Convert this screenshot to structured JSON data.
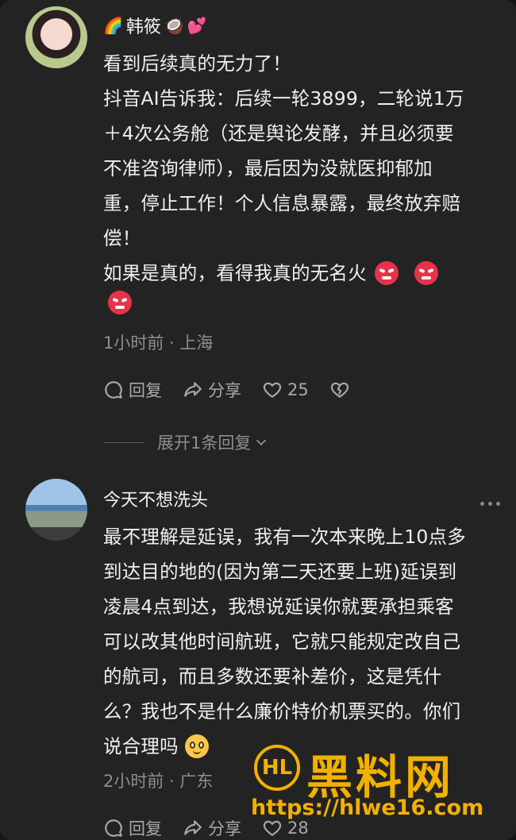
{
  "comments": [
    {
      "author": "韩筱",
      "author_prefix_emoji": "🌈",
      "author_suffix_emojis": [
        "🥥",
        "💕"
      ],
      "lines": [
        "看到后续真的无力了！",
        "抖音AI告诉我：后续一轮3899，二轮说1万",
        "＋4次公务舱（还是舆论发酵，并且必须要",
        "不准咨询律师），最后因为没就医抑郁加",
        "重，停止工作！个人信息暴露，最终放弃赔",
        "偿！",
        "如果是真的，看得我真的无名火"
      ],
      "trailing_emojis": [
        "angry-face",
        "angry-face",
        "angry-face"
      ],
      "meta": "1小时前 · 上海",
      "reply_label": "回复",
      "share_label": "分享",
      "like_count": "25",
      "expand_label": "展开1条回复"
    },
    {
      "author": "今天不想洗头",
      "lines": [
        "最不理解是延误，我有一次本来晚上10点多",
        "到达目的地的(因为第二天还要上班)延误到",
        "凌晨4点到达，我想说延误你就要承担乘客",
        "可以改其他时间航班，它就只能规定改自己",
        "的航司，而且多数还要补差价，这是凭什",
        "么？我也不是什么廉价特价机票买的。你们",
        "说合理吗"
      ],
      "trailing_emojis": [
        "smile-face"
      ],
      "meta": "2小时前 · 广东",
      "reply_label": "回复",
      "share_label": "分享",
      "like_count": "28"
    }
  ],
  "watermark": {
    "logo_letters": "HL",
    "title": "黑料网",
    "url": "https://hlwe16.com"
  },
  "colors": {
    "background": "#232323",
    "text": "#f0f0f0",
    "muted": "#8e8e8e",
    "watermark": "#f2b100",
    "angry": "#e8324a"
  }
}
